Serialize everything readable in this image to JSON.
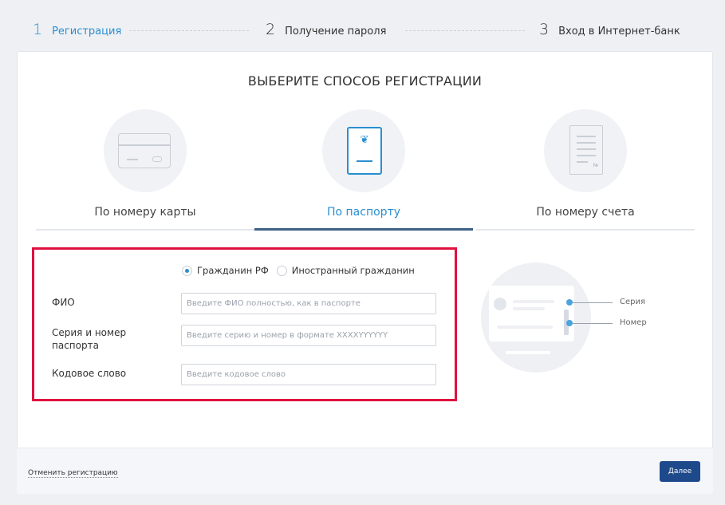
{
  "steps": [
    {
      "num": "1",
      "label": "Регистрация"
    },
    {
      "num": "2",
      "label": "Получение пароля"
    },
    {
      "num": "3",
      "label": "Вход в Интернет-банк"
    }
  ],
  "heading": "ВЫБЕРИТЕ СПОСОБ РЕГИСТРАЦИИ",
  "methods": [
    {
      "label": "По номеру карты",
      "icon": "bank-card-icon"
    },
    {
      "label": "По паспорту",
      "icon": "passport-icon"
    },
    {
      "label": "По номеру счета",
      "icon": "account-statement-icon"
    }
  ],
  "method_icons": {
    "passport_emblem": "❦",
    "statement_no": "№"
  },
  "form": {
    "citizenship": [
      {
        "label": "Гражданин РФ",
        "checked": true
      },
      {
        "label": "Иностранный гражданин",
        "checked": false
      }
    ],
    "fio": {
      "label": "ФИО",
      "placeholder": "Введите ФИО полностью, как в паспорте"
    },
    "passport": {
      "label": "Серия и номер паспорта",
      "placeholder": "Введите серию и номер в формате XXXXYYYYYY"
    },
    "code": {
      "label": "Кодовое слово",
      "placeholder": "Введите кодовое слово"
    }
  },
  "illustration": {
    "series_label": "Серия",
    "number_label": "Номер"
  },
  "footer": {
    "cancel": "Отменить регистрацию",
    "next": "Далее"
  },
  "colors": {
    "accent": "#2a8fd0",
    "highlight_border": "#e0103f",
    "button": "#1e4a8c"
  }
}
